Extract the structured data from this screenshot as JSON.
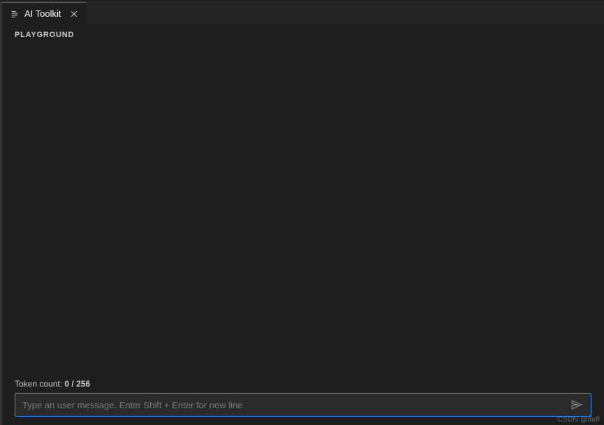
{
  "tab": {
    "title": "AI Toolkit"
  },
  "section": {
    "title": "PLAYGROUND"
  },
  "footer": {
    "token_label": "Token count: ",
    "token_value": "0 / 256",
    "input_placeholder": "Type an user message. Enter Shift + Enter for new line",
    "input_value": ""
  },
  "watermark": "CSDN @ituff"
}
